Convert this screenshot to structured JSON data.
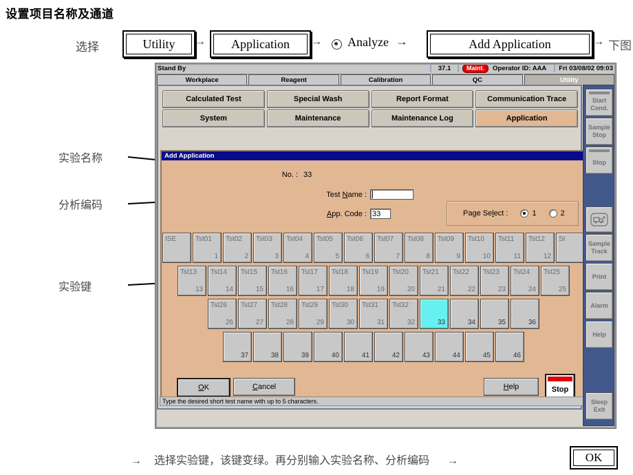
{
  "doc": {
    "title": "设置项目名称及通道",
    "flow": {
      "label": "选择",
      "step1": "Utility",
      "step2": "Application",
      "radio_option": "Analyze",
      "step3": "Add  Application",
      "end": "下图",
      "arrow": "→"
    },
    "annotations": {
      "test_name": "实验名称",
      "app_code": "分析编码",
      "test_key": "实验键"
    },
    "bottom": {
      "arrow": "→",
      "text": "选择实验键，该键变绿。再分别输入实验名称、分析编码",
      "arrow2": "→",
      "ok": "OK"
    }
  },
  "app": {
    "statusbar": {
      "state": "Stand By",
      "temperature": "37.1",
      "maint_badge": "Maint.",
      "operator": "Operator ID: AAA",
      "datetime": "Fri 03/08/02 09:03"
    },
    "main_tabs": [
      {
        "label": "Workplace",
        "active": false
      },
      {
        "label": "Reagent",
        "active": false
      },
      {
        "label": "Calibration",
        "active": false
      },
      {
        "label": "QC",
        "active": false
      },
      {
        "label": "Utility",
        "active": true
      }
    ],
    "sub_tabs_row1": [
      {
        "label": "Calculated Test",
        "active": false
      },
      {
        "label": "Special Wash",
        "active": false
      },
      {
        "label": "Report Format",
        "active": false
      },
      {
        "label": "Communication Trace",
        "active": false
      }
    ],
    "sub_tabs_row2": [
      {
        "label": "System",
        "active": false
      },
      {
        "label": "Maintenance",
        "active": false
      },
      {
        "label": "Maintenance Log",
        "active": false
      },
      {
        "label": "Application",
        "active": true
      }
    ],
    "dialog": {
      "title": "Add Application",
      "no_label": "No. :",
      "no_value": "33",
      "test_name_label": "Test Name :",
      "test_name_value": "",
      "app_code_label": "App. Code :",
      "app_code_value": "33",
      "page_select": {
        "label": "Page Select :",
        "options": [
          {
            "label": "1",
            "selected": true
          },
          {
            "label": "2",
            "selected": false
          }
        ]
      },
      "buttons": {
        "ok": "OK",
        "cancel": "Cancel",
        "help": "Help",
        "stop": "Stop"
      },
      "grid_rows": [
        [
          {
            "name": "ISE",
            "num": ""
          },
          {
            "name": "Tst01",
            "num": "1"
          },
          {
            "name": "Tst02",
            "num": "2"
          },
          {
            "name": "Tst03",
            "num": "3"
          },
          {
            "name": "Tst04",
            "num": "4"
          },
          {
            "name": "Tst05",
            "num": "5"
          },
          {
            "name": "Tst06",
            "num": "6"
          },
          {
            "name": "Tst07",
            "num": "7"
          },
          {
            "name": "Tst08",
            "num": "8"
          },
          {
            "name": "Tst09",
            "num": "9"
          },
          {
            "name": "Tst10",
            "num": "10"
          },
          {
            "name": "Tst11",
            "num": "11"
          },
          {
            "name": "Tst12",
            "num": "12"
          },
          {
            "name": "SI",
            "num": ""
          }
        ],
        [
          {
            "name": "Tst13",
            "num": "13"
          },
          {
            "name": "Tst14",
            "num": "14"
          },
          {
            "name": "Tst15",
            "num": "15"
          },
          {
            "name": "Tst16",
            "num": "16"
          },
          {
            "name": "Tst17",
            "num": "17"
          },
          {
            "name": "Tst18",
            "num": "18"
          },
          {
            "name": "Tst19",
            "num": "19"
          },
          {
            "name": "Tst20",
            "num": "20"
          },
          {
            "name": "Tst21",
            "num": "21"
          },
          {
            "name": "Tst22",
            "num": "22"
          },
          {
            "name": "Tst23",
            "num": "23"
          },
          {
            "name": "Tst24",
            "num": "24"
          },
          {
            "name": "Tst25",
            "num": "25"
          }
        ],
        [
          {
            "name": "Tst26",
            "num": "26"
          },
          {
            "name": "Tst27",
            "num": "27"
          },
          {
            "name": "Tst28",
            "num": "28"
          },
          {
            "name": "Tst29",
            "num": "29"
          },
          {
            "name": "Tst30",
            "num": "30"
          },
          {
            "name": "Tst31",
            "num": "31"
          },
          {
            "name": "Tst32",
            "num": "32"
          },
          {
            "name": "",
            "num": "33",
            "selected": true
          },
          {
            "name": "",
            "num": "34"
          },
          {
            "name": "",
            "num": "35"
          },
          {
            "name": "",
            "num": "36"
          }
        ],
        [
          {
            "name": "",
            "num": "37"
          },
          {
            "name": "",
            "num": "38"
          },
          {
            "name": "",
            "num": "39"
          },
          {
            "name": "",
            "num": "40"
          },
          {
            "name": "",
            "num": "41"
          },
          {
            "name": "",
            "num": "42"
          },
          {
            "name": "",
            "num": "43"
          },
          {
            "name": "",
            "num": "44"
          },
          {
            "name": "",
            "num": "45"
          },
          {
            "name": "",
            "num": "46"
          }
        ]
      ]
    },
    "message_bar": "Type the desired short test name with up to 5 characters.",
    "rail_buttons": [
      {
        "label1": "Start",
        "label2": "Cond.",
        "topbar": true
      },
      {
        "label1": "Sample",
        "label2": "Stop",
        "topbar": false
      },
      {
        "label1": "Stop",
        "label2": "",
        "topbar": true
      },
      {
        "label1": "",
        "label2": "",
        "icon": "sample-load-icon"
      },
      {
        "label1": "Sample",
        "label2": "Track"
      },
      {
        "label1": "Print",
        "label2": ""
      },
      {
        "label1": "Alarm",
        "label2": ""
      },
      {
        "label1": "Help",
        "label2": ""
      },
      {
        "label1": "Sleep",
        "label2": "Exit"
      }
    ],
    "colors": {
      "dialog_bg": "#e2b793",
      "title_bar": "#0a0a8c",
      "selected_key": "#66f0f0",
      "maint_badge": "#e00000",
      "rail_bg": "#41588c"
    }
  }
}
